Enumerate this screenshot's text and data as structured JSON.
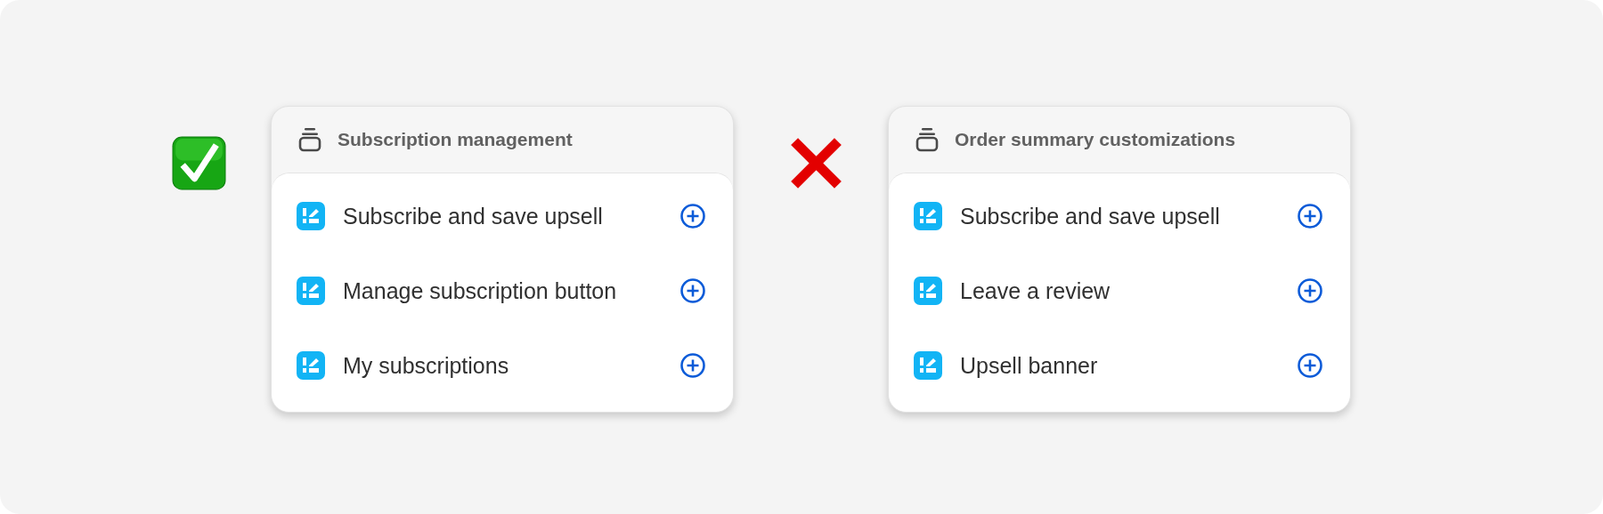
{
  "groups": [
    {
      "mark": {
        "kind": "check"
      },
      "title": "Subscription management",
      "items": [
        {
          "label": "Subscribe and save upsell"
        },
        {
          "label": "Manage subscription button"
        },
        {
          "label": "My subscriptions"
        }
      ]
    },
    {
      "mark": {
        "kind": "cross"
      },
      "title": "Order summary customizations",
      "items": [
        {
          "label": "Subscribe and save upsell"
        },
        {
          "label": "Leave a review"
        },
        {
          "label": "Upsell banner"
        }
      ]
    }
  ]
}
